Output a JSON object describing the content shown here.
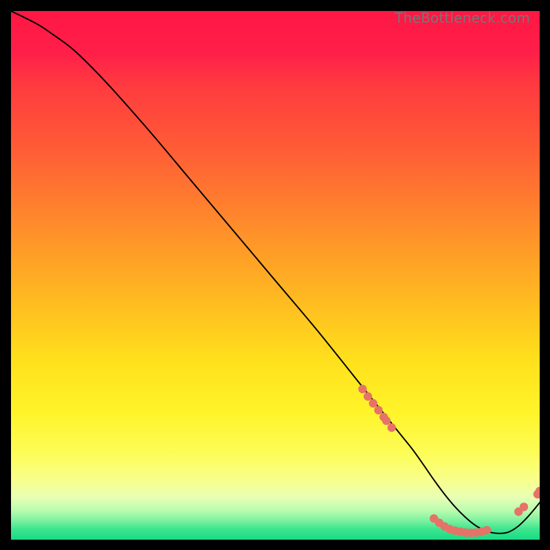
{
  "credit": "TheBottleneck.com",
  "colors": {
    "line": "#000000",
    "marker": "#e57368",
    "bg_black": "#000000"
  },
  "chart_data": {
    "type": "line",
    "title": "",
    "xlabel": "",
    "ylabel": "",
    "xlim": [
      0,
      100
    ],
    "ylim": [
      0,
      100
    ],
    "series": [
      {
        "name": "curve",
        "x": [
          0,
          5,
          8,
          12,
          18,
          26,
          34,
          42,
          50,
          58,
          66,
          70,
          72,
          74,
          76,
          78,
          80,
          82,
          84,
          86,
          88,
          90,
          92,
          94,
          96,
          98,
          100
        ],
        "y": [
          100,
          97.5,
          95.5,
          92.5,
          86.5,
          77.5,
          68,
          58.5,
          49,
          39.5,
          29.5,
          24.5,
          22,
          19.5,
          17,
          14.2,
          11.3,
          8.6,
          6.2,
          4.2,
          2.6,
          1.6,
          1.2,
          1.4,
          2.6,
          4.6,
          7.0
        ]
      }
    ],
    "markers": [
      {
        "x": 66.5,
        "y": 28.5
      },
      {
        "x": 67.5,
        "y": 27.1
      },
      {
        "x": 68.5,
        "y": 25.8
      },
      {
        "x": 69.5,
        "y": 24.5
      },
      {
        "x": 70.5,
        "y": 23.2
      },
      {
        "x": 71.0,
        "y": 22.5
      },
      {
        "x": 72.0,
        "y": 21.2
      },
      {
        "x": 80.0,
        "y": 4.0
      },
      {
        "x": 81.0,
        "y": 3.2
      },
      {
        "x": 82.0,
        "y": 2.5
      },
      {
        "x": 83.0,
        "y": 2.0
      },
      {
        "x": 84.0,
        "y": 1.7
      },
      {
        "x": 85.0,
        "y": 1.5
      },
      {
        "x": 86.0,
        "y": 1.35
      },
      {
        "x": 87.0,
        "y": 1.3
      },
      {
        "x": 88.0,
        "y": 1.35
      },
      {
        "x": 89.0,
        "y": 1.5
      },
      {
        "x": 90.0,
        "y": 1.8
      },
      {
        "x": 96.0,
        "y": 5.3
      },
      {
        "x": 97.0,
        "y": 6.2
      },
      {
        "x": 99.6,
        "y": 8.6
      },
      {
        "x": 100.0,
        "y": 9.2
      }
    ]
  }
}
